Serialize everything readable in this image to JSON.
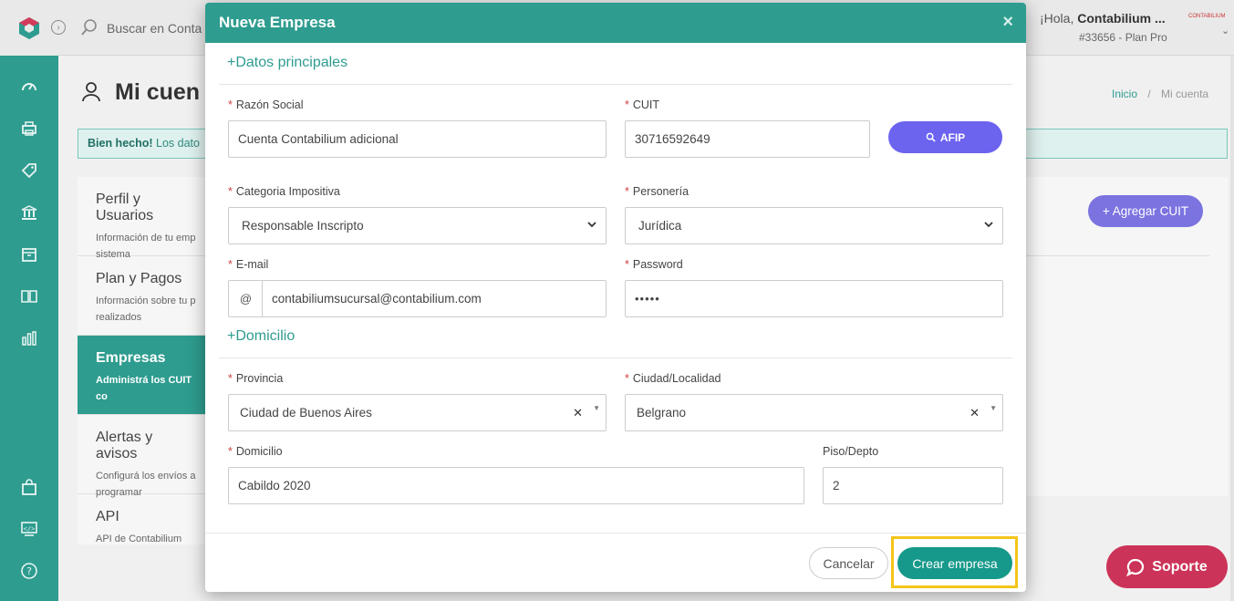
{
  "topbar": {
    "search_placeholder": "Buscar en Conta",
    "greeting_prefix": "¡Hola, ",
    "greeting_name": "Contabilium ...",
    "plan": "#33656 - Plan Pro",
    "brand_mini": "CONTABILIUM"
  },
  "page": {
    "title": "Mi cuen",
    "breadcrumb_home": "Inicio",
    "breadcrumb_sep": "/",
    "breadcrumb_current": "Mi cuenta",
    "alert_strong": "Bien hecho!",
    "alert_text": " Los dato",
    "add_cuit": "+ Agregar CUIT",
    "support": "Soporte"
  },
  "menu": [
    {
      "title": "Perfil y Usuarios",
      "desc": "Información de tu emp sistema"
    },
    {
      "title": "Plan y Pagos",
      "desc": "Información sobre tu p realizados"
    },
    {
      "title": "Empresas",
      "desc": "Administrá los CUIT co"
    },
    {
      "title": "Alertas y avisos",
      "desc": "Configurá los envíos a programar"
    },
    {
      "title": "API",
      "desc": "API de Contabilium"
    }
  ],
  "modal": {
    "title": "Nueva Empresa",
    "close": "×",
    "section_main": "+Datos principales",
    "section_address": "+Domicilio",
    "fields": {
      "razon_social": {
        "label": "Razón Social",
        "value": "Cuenta Contabilium adicional"
      },
      "cuit": {
        "label": "CUIT",
        "value": "30716592649"
      },
      "afip": "AFIP",
      "categoria": {
        "label": "Categoria Impositiva",
        "value": "Responsable Inscripto"
      },
      "personeria": {
        "label": "Personería",
        "value": "Jurídica"
      },
      "email": {
        "label": "E-mail",
        "addon": "@",
        "value": "contabiliumsucursal@contabilium.com"
      },
      "password": {
        "label": "Password",
        "value": "•••••"
      },
      "provincia": {
        "label": "Provincia",
        "value": "Ciudad de Buenos Aires"
      },
      "ciudad": {
        "label": "Ciudad/Localidad",
        "value": "Belgrano"
      },
      "domicilio": {
        "label": "Domicilio",
        "value": "Cabildo 2020"
      },
      "piso": {
        "label": "Piso/Depto",
        "value": "2"
      }
    },
    "required_mark": "*",
    "cancel": "Cancelar",
    "create": "Crear empresa"
  },
  "colors": {
    "primary": "#2e9c8f",
    "afip": "#6c63ef",
    "support": "#cc3358",
    "highlight": "#f5c518"
  }
}
